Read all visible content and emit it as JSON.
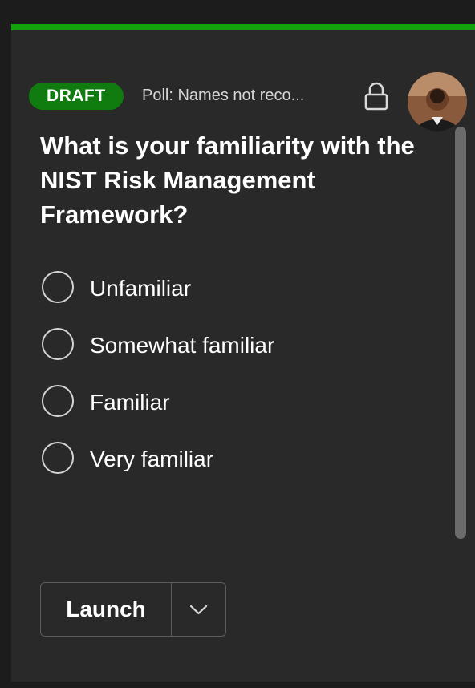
{
  "header": {
    "badge": "DRAFT",
    "poll_title": "Poll: Names not reco...",
    "lock_icon": "lock-icon",
    "avatar_icon": "user-avatar"
  },
  "question": "What is your familiarity with the NIST Risk Management Framework?",
  "options": [
    {
      "label": "Unfamiliar"
    },
    {
      "label": "Somewhat familiar"
    },
    {
      "label": "Familiar"
    },
    {
      "label": "Very familiar"
    }
  ],
  "actions": {
    "launch_label": "Launch",
    "more_icon": "chevron-down-icon"
  },
  "colors": {
    "accent": "#13a10e",
    "badge": "#107c10",
    "panel": "#292929"
  }
}
